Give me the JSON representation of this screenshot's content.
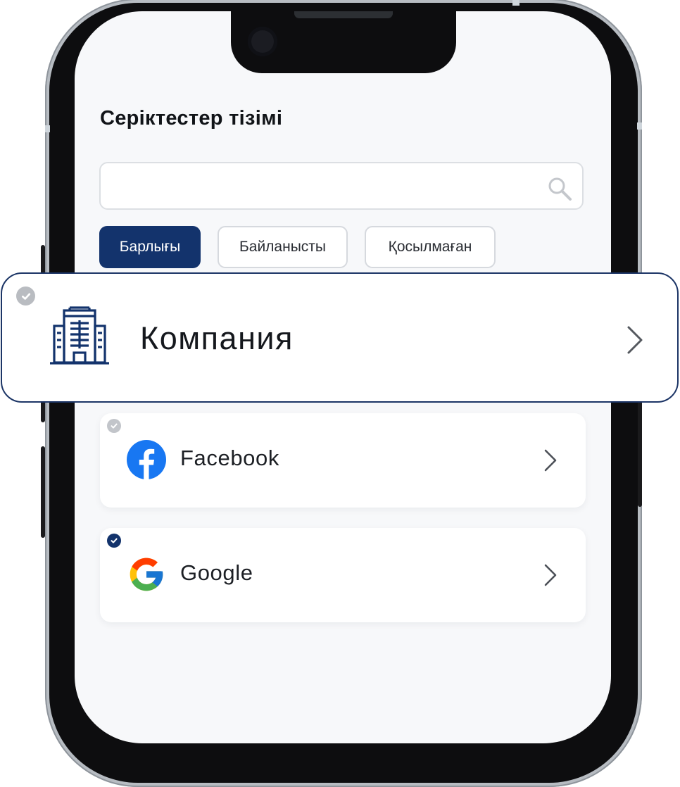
{
  "header": {
    "title": "Серіктестер тізімі"
  },
  "search": {
    "placeholder": "",
    "value": ""
  },
  "filters": [
    {
      "label": "Барлығы",
      "active": true
    },
    {
      "label": "Байланысты",
      "active": false
    },
    {
      "label": "Қосылмаған",
      "active": false
    }
  ],
  "highlighted_item": {
    "label": "Компания",
    "icon": "building-icon",
    "checked": false
  },
  "partners": [
    {
      "label": "Facebook",
      "icon": "facebook-icon",
      "checked": false
    },
    {
      "label": "Google",
      "icon": "google-icon",
      "checked": true
    }
  ],
  "colors": {
    "accent": "#13336c",
    "badge_checked": "#13336c",
    "badge_unchecked": "#c2c5ca",
    "facebook_blue": "#1877f2",
    "screen_bg": "#f7f8fa"
  }
}
